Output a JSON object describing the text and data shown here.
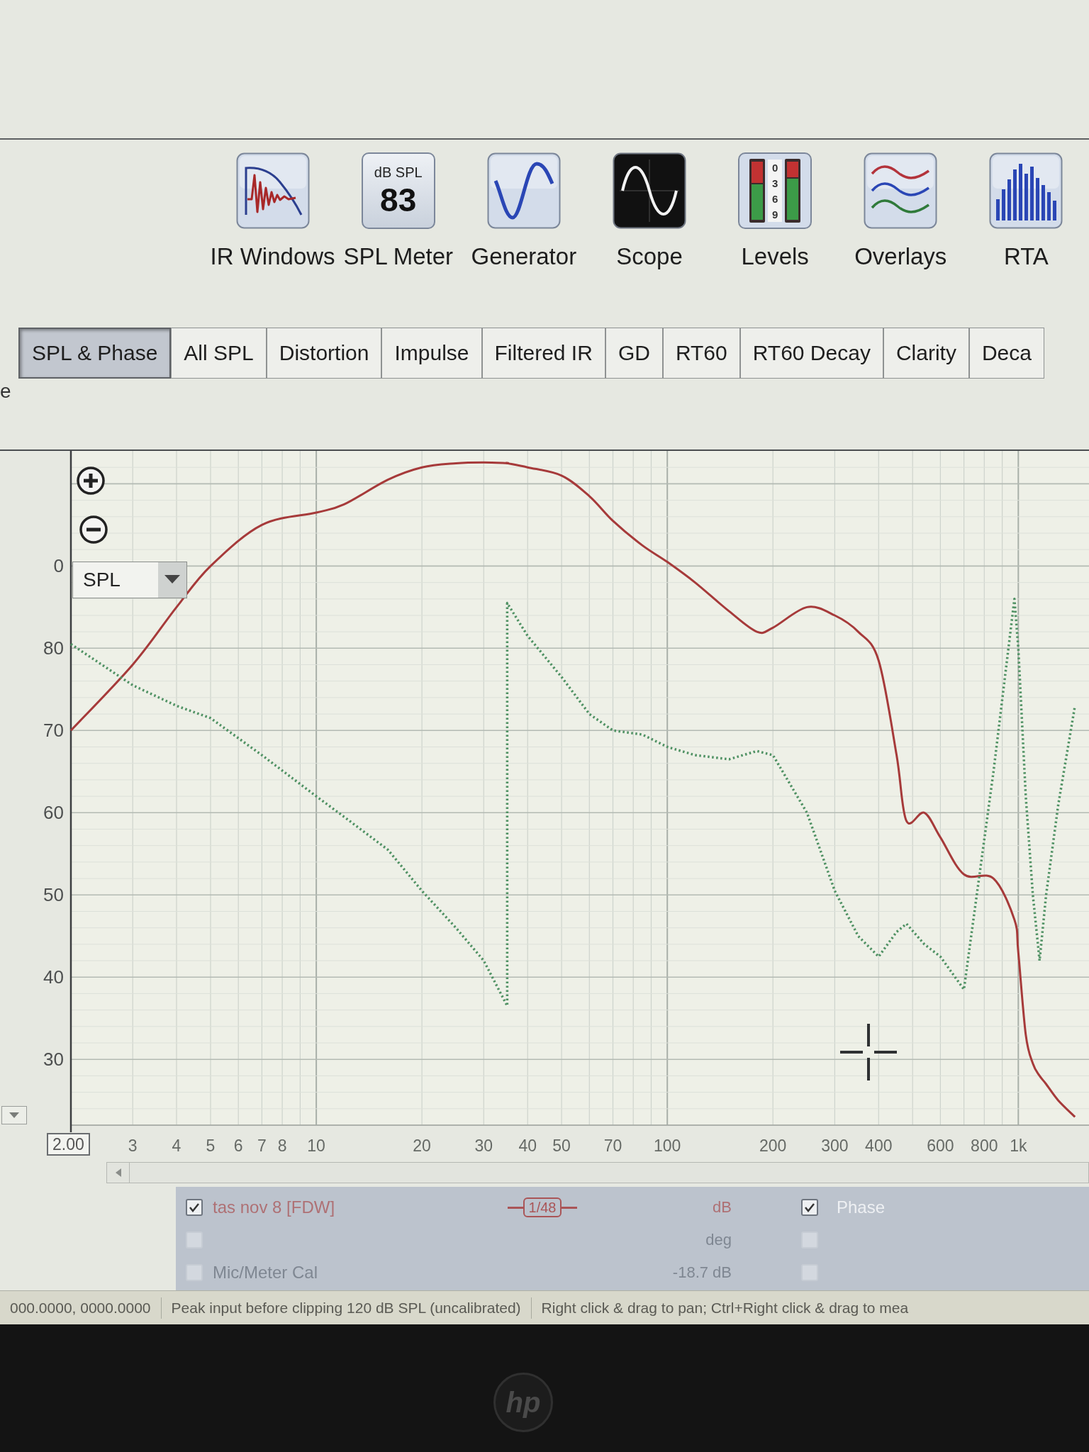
{
  "side_fragment": "e",
  "toolbar": [
    {
      "kind": "ir",
      "label": "IR Windows"
    },
    {
      "kind": "meter",
      "label": "SPL Meter",
      "unit": "dB SPL",
      "reading": "83"
    },
    {
      "kind": "generator",
      "label": "Generator"
    },
    {
      "kind": "scope",
      "label": "Scope"
    },
    {
      "kind": "levels",
      "label": "Levels",
      "scale": [
        "0",
        "3",
        "6",
        "9"
      ]
    },
    {
      "kind": "overlays",
      "label": "Overlays"
    },
    {
      "kind": "rta",
      "label": "RTA"
    }
  ],
  "tabs": [
    {
      "label": "SPL & Phase",
      "selected": true
    },
    {
      "label": "All SPL",
      "selected": false
    },
    {
      "label": "Distortion",
      "selected": false
    },
    {
      "label": "Impulse",
      "selected": false
    },
    {
      "label": "Filtered IR",
      "selected": false
    },
    {
      "label": "GD",
      "selected": false
    },
    {
      "label": "RT60",
      "selected": false
    },
    {
      "label": "RT60 Decay",
      "selected": false
    },
    {
      "label": "Clarity",
      "selected": false
    },
    {
      "label": "Deca",
      "selected": false
    }
  ],
  "graph": {
    "view_select": "SPL",
    "range_start": "2.00",
    "cut_tick_label": "0",
    "chart_data": {
      "type": "line",
      "log": "x",
      "grid": true,
      "x": [
        2,
        3,
        4,
        5,
        7,
        10,
        12,
        16,
        20,
        25,
        30,
        35,
        35,
        40,
        50,
        60,
        70,
        85,
        100,
        120,
        150,
        180,
        200,
        250,
        300,
        350,
        400,
        450,
        480,
        540,
        600,
        700,
        850,
        975,
        1000,
        1050,
        1100,
        1150,
        1200,
        1300,
        1450
      ],
      "series": [
        {
          "name": "tas nov 8 [FDW]",
          "color": "#a63a3a",
          "values": [
            70,
            78,
            85,
            90,
            95,
            96.5,
            97.5,
            100.5,
            102,
            102.5,
            102.6,
            102.5,
            102.5,
            102,
            101,
            98.5,
            95.5,
            92.5,
            90.5,
            88,
            84.5,
            82,
            82.5,
            85,
            84,
            82,
            78.5,
            67,
            59,
            60,
            57,
            52.5,
            52,
            47,
            43,
            33,
            29.5,
            28,
            27,
            25,
            23
          ]
        },
        {
          "name": "Phase",
          "color": "#4f9163",
          "line_style": "dotted",
          "values": [
            80.5,
            75.5,
            73,
            71.5,
            67,
            62,
            59.5,
            55.5,
            50.5,
            46,
            42,
            36.5,
            85.5,
            81.5,
            76.5,
            72,
            70,
            69.5,
            68,
            67,
            66.5,
            67.5,
            67,
            60,
            50.5,
            45,
            42.5,
            45.5,
            46.5,
            44,
            42.5,
            38.5,
            65,
            86,
            80,
            62,
            50,
            42,
            50,
            61,
            73
          ]
        }
      ],
      "xlim": [
        2,
        1590
      ],
      "ylim": [
        22,
        104
      ],
      "xticks": [
        3,
        4,
        5,
        6,
        7,
        8,
        10,
        20,
        30,
        40,
        50,
        70,
        100,
        200,
        300,
        400,
        600,
        800,
        {
          "value": 1000,
          "label": "1k"
        }
      ],
      "yticks": [
        80,
        70,
        60,
        50,
        40,
        30
      ]
    }
  },
  "legend": {
    "rows": [
      {
        "checked": true,
        "line_style": "1/48",
        "reading": "dB",
        "side_checked": true
      },
      {
        "checked": false,
        "reading": "deg",
        "side_checked": false
      },
      {
        "checked": false,
        "label": "Mic/Meter Cal",
        "reading": "-18.7 dB",
        "side_checked": false
      }
    ]
  },
  "status_bar": {
    "cells": [
      "000.0000, 0000.0000",
      "Peak input before clipping 120 dB SPL (uncalibrated)",
      "Right click & drag to pan; Ctrl+Right click & drag to mea"
    ]
  },
  "bezel": {
    "logo": "hp"
  }
}
